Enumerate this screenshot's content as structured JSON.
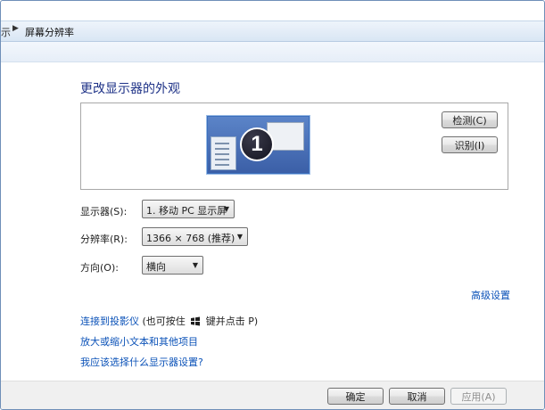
{
  "breadcrumb": {
    "prev": "示",
    "current": "屏幕分辨率"
  },
  "page_title": "更改显示器的外观",
  "preview": {
    "monitor_number": "1"
  },
  "buttons": {
    "detect": "检测(C)",
    "identify": "识别(I)",
    "ok": "确定",
    "cancel": "取消",
    "apply": "应用(A)"
  },
  "fields": {
    "display": {
      "label": "显示器(S):",
      "value": "1. 移动 PC 显示屏"
    },
    "resolution": {
      "label": "分辨率(R):",
      "value": "1366 × 768 (推荐)"
    },
    "orientation": {
      "label": "方向(O):",
      "value": "横向"
    }
  },
  "links": {
    "advanced": "高级设置",
    "projector": "连接到投影仪",
    "projector_hint_prefix": " (也可按住 ",
    "projector_hint_suffix": " 键并点击 P)",
    "text_size": "放大或缩小文本和其他项目",
    "which_settings": "我应该选择什么显示器设置?"
  },
  "colors": {
    "title": "#1e3287",
    "link": "#0b52b8",
    "monitor": "#3b5fa7"
  }
}
